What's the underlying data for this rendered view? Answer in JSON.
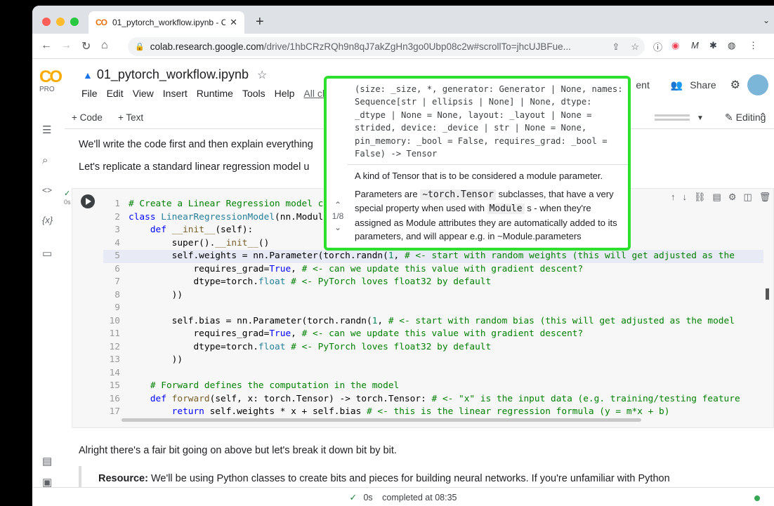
{
  "browser": {
    "tab_title": "01_pytorch_workflow.ipynb - C",
    "tab_logo": "CO",
    "new_tab": "+",
    "url_host": "colab.research.google.com",
    "url_path": "/drive/1hbCRzRQh9n8qJ7akZgHn3go0Ubp08c2w#scrollTo=jhcUJBFue..."
  },
  "colab": {
    "logo": "CO",
    "plan": "PRO",
    "notebook_title": "01_pytorch_workflow.ipynb",
    "menus": [
      "File",
      "Edit",
      "View",
      "Insert",
      "Runtime",
      "Tools",
      "Help"
    ],
    "all_changes": "All ch",
    "comment_fragment": "ent",
    "share_label": "Share",
    "add_code": "+ Code",
    "add_text": "+ Text",
    "editing_label": "Editing"
  },
  "text_cells": {
    "p1": "We'll write the code first and then explain everything",
    "p2": "Let's replicate a standard linear regression model u",
    "p3": "Alright there's a fair bit going on above but let's break it down bit by bit.",
    "resource_label": "Resource:",
    "resource_text": " We'll be using Python classes to create bits and pieces for building neural networks. If you're unfamiliar with Python"
  },
  "code_cell": {
    "exec_time": "0s",
    "line_numbers": [
      "1",
      "2",
      "3",
      "4",
      "5",
      "6",
      "7",
      "8",
      "9",
      "10",
      "11",
      "12",
      "13",
      "14",
      "15",
      "16",
      "17"
    ]
  },
  "tooltip": {
    "signature": "(size: _size, *, generator: Generator | None, names: Sequence[str | ellipsis | None] | None, dtype: _dtype | None = None, layout: _layout | None = strided, device: _device | str | None = None, pin_memory: _bool = False, requires_grad: _bool = False) -> Tensor",
    "summary": "A kind of Tensor that is to be considered a module parameter.",
    "detail_1": "Parameters are ",
    "detail_code_1": "~torch.Tensor",
    "detail_2": " subclasses, that have a very special property when used with ",
    "detail_code_2": "Module",
    "detail_3": " s - when they're assigned as Module attributes they are automatically added to its parameters, and will appear e.g. in ~Module.parameters",
    "page": "1/8"
  },
  "status": {
    "check": "✓",
    "time": "0s",
    "text": "completed at 08:35"
  }
}
